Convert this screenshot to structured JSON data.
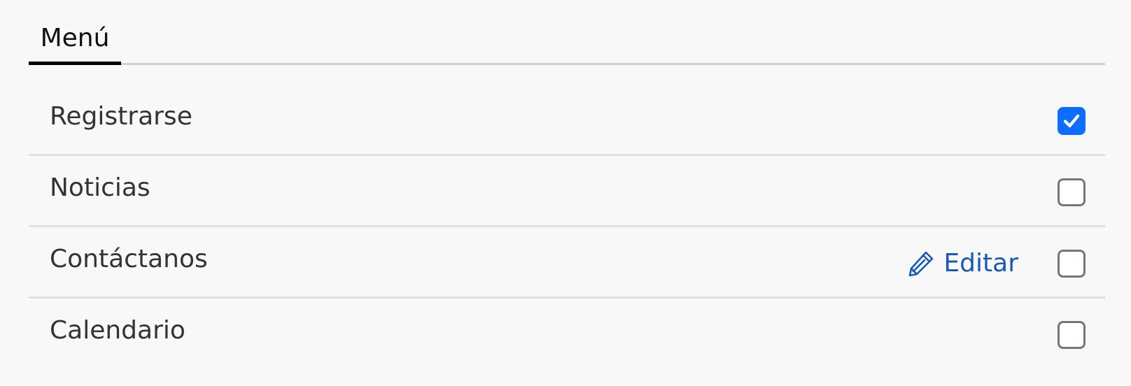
{
  "tab": {
    "label": "Menú"
  },
  "items": [
    {
      "label": "Registrarse",
      "checked": true
    },
    {
      "label": "Noticias",
      "checked": false
    },
    {
      "label": "Contáctanos",
      "checked": false,
      "edit_label": "Editar"
    },
    {
      "label": "Calendario",
      "checked": false
    }
  ],
  "colors": {
    "accent": "#0d6efd",
    "link": "#1a5aa8",
    "tab_indicator": "#000000"
  },
  "icons": {
    "edit": "pencil-icon",
    "checked": "check-icon"
  }
}
